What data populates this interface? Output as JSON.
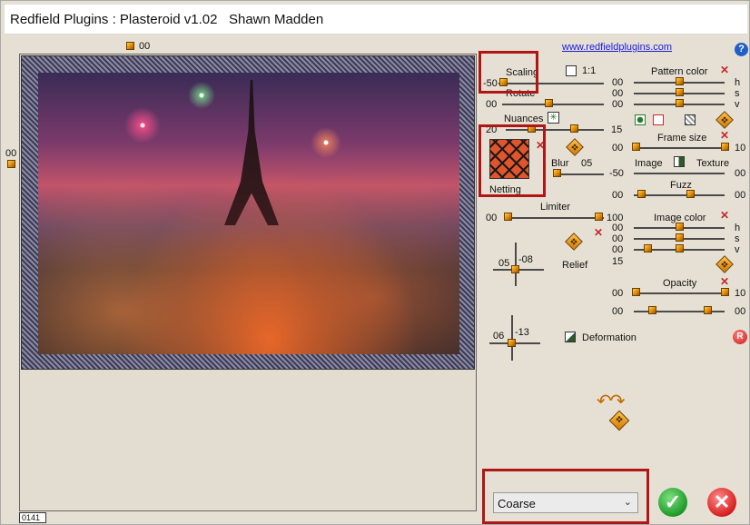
{
  "window": {
    "title": "Redfield Plugins : Plasteroid v1.02   Shawn Madden"
  },
  "preview": {
    "top_value": "00",
    "left_value": "00",
    "bottom_value": "0141"
  },
  "link": "www.redfieldplugins.com",
  "scaling": {
    "label": "Scaling",
    "value": "-50",
    "ratio_label": "1:1"
  },
  "rotate": {
    "label": "Rotate",
    "value": "00"
  },
  "nuances": {
    "label": "Nuances",
    "value_left": "20",
    "value_right": "15"
  },
  "netting": {
    "label": "Netting"
  },
  "blur": {
    "label": "Blur",
    "value": "05"
  },
  "limiter": {
    "label": "Limiter",
    "value_left": "00",
    "value_right": "100"
  },
  "relief": {
    "label": "Relief",
    "x": "05",
    "y": "-08"
  },
  "deformation": {
    "label": "Deformation",
    "x": "06",
    "y": "-13"
  },
  "pattern_color": {
    "label": "Pattern color",
    "h": "00",
    "s": "00",
    "v": "00",
    "h_label": "h",
    "s_label": "s",
    "v_label": "v"
  },
  "frame_size": {
    "label": "Frame size",
    "left": "00",
    "right": "10"
  },
  "image_texture": {
    "image_label": "Image",
    "texture_label": "Texture",
    "left": "-50",
    "right": "00"
  },
  "fuzz": {
    "label": "Fuzz",
    "left": "00",
    "right": "00"
  },
  "image_color": {
    "label": "Image color",
    "h": "00",
    "s": "00",
    "v": "00",
    "v_right": "15",
    "h_label": "h",
    "s_label": "s",
    "v_label": "v"
  },
  "opacity": {
    "label": "Opacity",
    "left": "00",
    "right": "10",
    "left2": "00",
    "right2": "00"
  },
  "quality_select": {
    "value": "Coarse"
  },
  "buttons": {
    "help": "?",
    "reset": "R"
  },
  "colors": {
    "accent": "#e08a00",
    "highlight": "#b01616",
    "netting": "#e2542c"
  }
}
